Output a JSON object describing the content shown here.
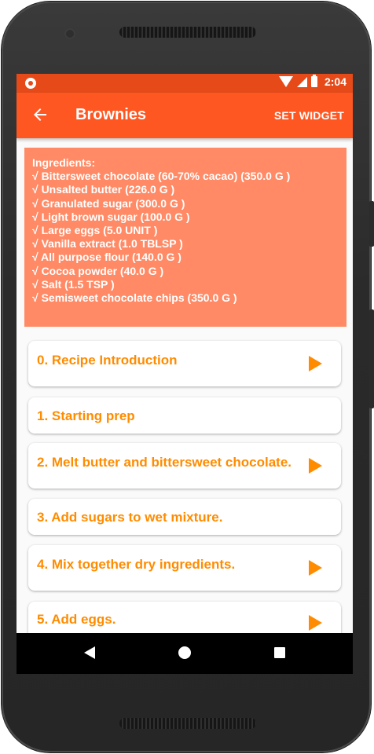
{
  "statusbar": {
    "time": "2:04"
  },
  "appbar": {
    "title": "Brownies",
    "action": "SET WIDGET",
    "back_icon": "arrow-left-icon"
  },
  "ingredients": {
    "header": "Ingredients:",
    "items": [
      "√ Bittersweet chocolate (60-70% cacao) (350.0 G )",
      "√ Unsalted butter (226.0 G )",
      "√ Granulated sugar (300.0 G )",
      "√ Light brown sugar (100.0 G )",
      "√ Large eggs (5.0 UNIT )",
      "√ Vanilla extract (1.0 TBLSP )",
      "√ All purpose flour (140.0 G )",
      "√ Cocoa powder (40.0 G )",
      "√ Salt (1.5 TSP )",
      "√ Semisweet chocolate chips (350.0 G )"
    ]
  },
  "steps": [
    {
      "label": "0. Recipe Introduction",
      "has_video": true
    },
    {
      "label": "1. Starting prep",
      "has_video": false
    },
    {
      "label": "2. Melt butter and bittersweet chocolate.",
      "has_video": true
    },
    {
      "label": "3. Add sugars to wet mixture.",
      "has_video": false
    },
    {
      "label": "4. Mix together dry ingredients.",
      "has_video": true
    },
    {
      "label": "5. Add eggs.",
      "has_video": true
    }
  ],
  "colors": {
    "statusbar": "#e64a19",
    "appbar": "#ff5722",
    "ingredients_bg": "#ff8a65",
    "step_text": "#ff8c00"
  }
}
